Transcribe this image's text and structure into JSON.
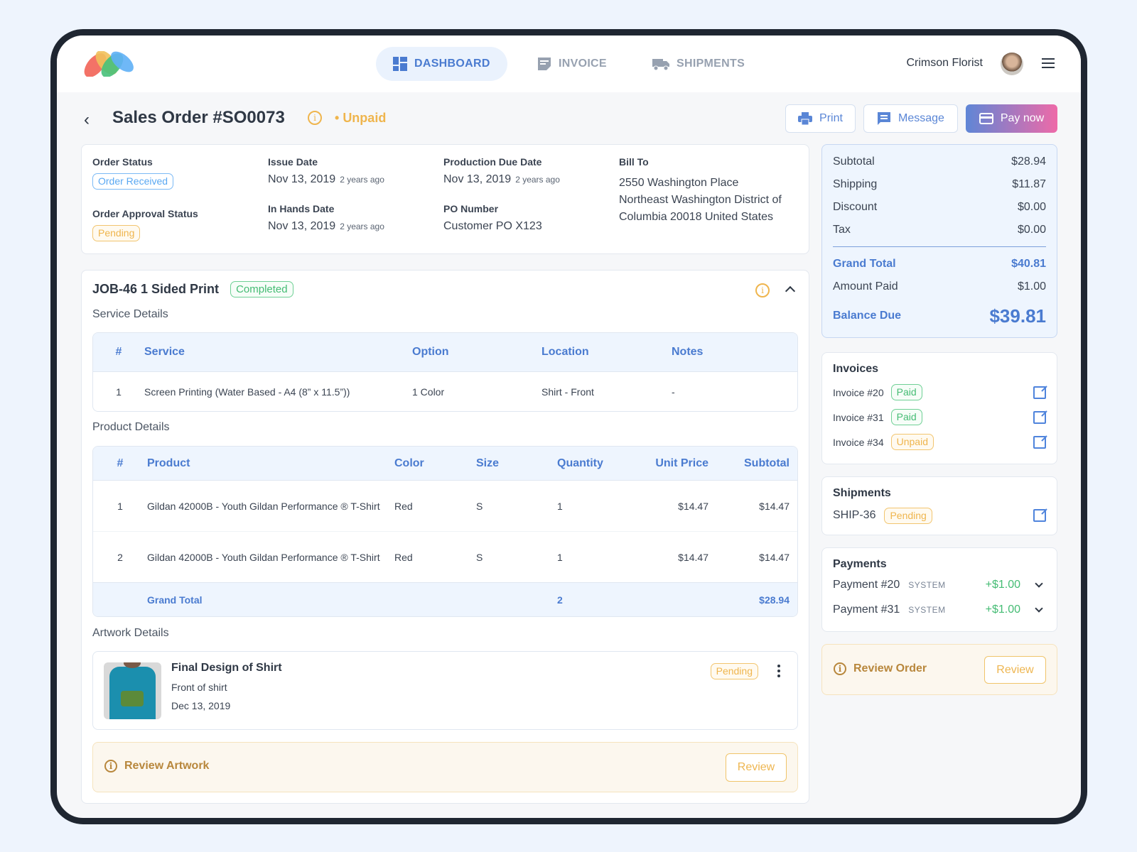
{
  "nav": {
    "user_name": "Crimson Florist",
    "tabs": [
      {
        "label": "DASHBOARD",
        "icon": "dashboard-icon",
        "active": true
      },
      {
        "label": "INVOICE",
        "icon": "invoice-icon"
      },
      {
        "label": "SHIPMENTS",
        "icon": "truck-icon"
      }
    ]
  },
  "page": {
    "title": "Sales Order #SO0073",
    "payment_status": "Unpaid",
    "actions": {
      "print": "Print",
      "message": "Message",
      "pay": "Pay now"
    }
  },
  "info": {
    "order_status_label": "Order Status",
    "order_status": "Order Received",
    "approval_label": "Order Approval Status",
    "approval": "Pending",
    "issue_label": "Issue Date",
    "issue_date": "Nov 13, 2019",
    "issue_ago": "2 years ago",
    "hands_label": "In Hands Date",
    "hands_date": "Nov 13, 2019",
    "hands_ago": "2 years ago",
    "prod_label": "Production Due Date",
    "prod_date": "Nov 13, 2019",
    "prod_ago": "2 years ago",
    "po_label": "PO Number",
    "po": "Customer PO X123",
    "bill_label": "Bill To",
    "bill_lines": [
      "2550 Washington Place",
      "Northeast Washington District of",
      "Columbia 20018 United States"
    ]
  },
  "job": {
    "title": "JOB-46 1 Sided Print",
    "status": "Completed",
    "service_label": "Service Details",
    "service_headers": [
      "#",
      "Service",
      "Option",
      "Location",
      "Notes"
    ],
    "service_rows": [
      [
        "1",
        "Screen Printing (Water Based - A4 (8” x 11.5”))",
        "1 Color",
        "Shirt - Front",
        "-"
      ]
    ],
    "product_label": "Product Details",
    "product_headers": [
      "#",
      "Product",
      "Color",
      "Size",
      "Quantity",
      "Unit Price",
      "Subtotal"
    ],
    "product_rows": [
      [
        "1",
        "Gildan 42000B - Youth Gildan Performance ® T-Shirt",
        "Red",
        "S",
        "1",
        "$14.47",
        "$14.47"
      ],
      [
        "2",
        "Gildan 42000B - Youth Gildan Performance ® T-Shirt",
        "Red",
        "S",
        "1",
        "$14.47",
        "$14.47"
      ]
    ],
    "product_total": {
      "label": "Grand Total",
      "quantity": "2",
      "subtotal": "$28.94"
    },
    "artwork_label": "Artwork Details",
    "artwork": {
      "title": "Final Design of Shirt",
      "subtitle": "Front of shirt",
      "date": "Dec 13, 2019",
      "status": "Pending"
    },
    "review": {
      "label": "Review Artwork",
      "button": "Review"
    }
  },
  "summary": {
    "rows": [
      {
        "label": "Subtotal",
        "value": "$28.94"
      },
      {
        "label": "Shipping",
        "value": "$11.87"
      },
      {
        "label": "Discount",
        "value": "$0.00"
      },
      {
        "label": "Tax",
        "value": "$0.00"
      }
    ],
    "grand_total_label": "Grand Total",
    "grand_total": "$40.81",
    "paid_label": "Amount Paid",
    "paid": "$1.00",
    "balance_label": "Balance Due",
    "balance": "$39.81"
  },
  "invoices": {
    "title": "Invoices",
    "items": [
      {
        "name": "Invoice #20",
        "status": "Paid"
      },
      {
        "name": "Invoice #31",
        "status": "Paid"
      },
      {
        "name": "Invoice #34",
        "status": "Unpaid"
      }
    ]
  },
  "shipments": {
    "title": "Shipments",
    "items": [
      {
        "name": "SHIP-36",
        "status": "Pending"
      }
    ]
  },
  "payments": {
    "title": "Payments",
    "items": [
      {
        "name": "Payment #20",
        "source": "SYSTEM",
        "amount": "+$1.00"
      },
      {
        "name": "Payment #31",
        "source": "SYSTEM",
        "amount": "+$1.00"
      }
    ]
  },
  "review_order": {
    "label": "Review Order",
    "button": "Review"
  },
  "colors": {
    "accent": "#4a7bd0",
    "warning": "#efb54d",
    "success": "#45bc74"
  }
}
